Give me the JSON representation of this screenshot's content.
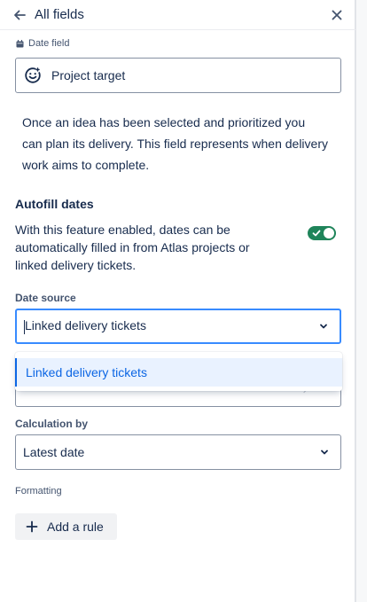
{
  "header": {
    "title": "All fields",
    "back_icon": "arrow-left-icon",
    "close_icon": "close-icon"
  },
  "field": {
    "type_label": "Date field",
    "type_icon": "calendar-icon",
    "name": "Project target",
    "emoji_icon": "smiley-icon",
    "description": "Once an idea has been selected and prioritized you can plan its delivery. This field represents when delivery work aims to complete."
  },
  "autofill": {
    "title": "Autofill dates",
    "description": "With this feature enabled, dates can be automatically filled in from Atlas projects or linked delivery tickets.",
    "enabled": true
  },
  "date_source": {
    "label": "Date source",
    "value": "Linked delivery tickets",
    "options": [
      "Linked delivery tickets"
    ]
  },
  "calculation": {
    "label": "Calculation by",
    "value": "Latest date"
  },
  "formatting": {
    "label": "Formatting",
    "add_rule_label": "Add a rule"
  },
  "colors": {
    "toggle_on": "#1f845a",
    "focus_border": "#388bff",
    "option_selected_bg": "#e9f2ff",
    "option_selected_text": "#0c66e4"
  }
}
